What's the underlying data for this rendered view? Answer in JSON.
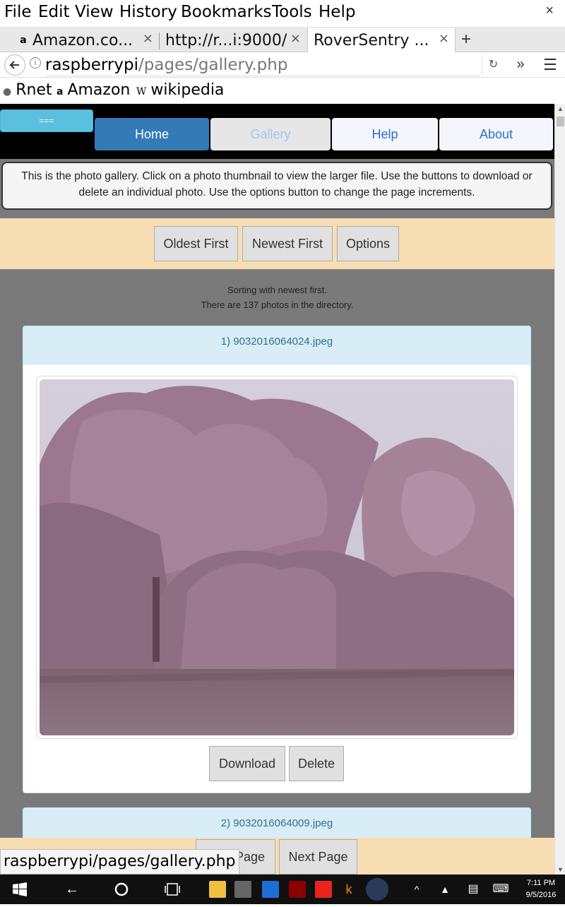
{
  "menubar": {
    "items": [
      "File",
      "Edit",
      "View",
      "History",
      "Bookmarks",
      "Tools",
      "Help"
    ],
    "close": "×"
  },
  "tabs": [
    {
      "label": "Amazon.co...",
      "favicon": "a"
    },
    {
      "label": "http://r...i:9000/"
    },
    {
      "label": "RoverSentry ..."
    }
  ],
  "tab_close": "×",
  "new_tab": "+",
  "urlbar": {
    "host": "raspberrypi",
    "path": "/pages/gallery.php"
  },
  "bookmarks": [
    {
      "label": "Rnet",
      "icon": "globe-icon"
    },
    {
      "label": "Amazon",
      "icon": "amazon-icon"
    },
    {
      "label": "wikipedia",
      "icon": "wikipedia-icon"
    }
  ],
  "nav": {
    "toggle": "===",
    "home": "Home",
    "gallery": "Gallery",
    "help": "Help",
    "about": "About"
  },
  "intro": "This is the photo gallery. Click on a photo thumbnail to view the larger file. Use the buttons to download or delete an individual photo. Use the options button to change the page increments.",
  "sort": {
    "oldest": "Oldest First",
    "newest": "Newest First",
    "options": "Options"
  },
  "status": {
    "line1": "Sorting with newest first.",
    "line2": "There are 137 photos in the directory."
  },
  "photos": [
    {
      "title": "1) 9032016064024.jpeg"
    },
    {
      "title": "2) 9032016064009.jpeg"
    }
  ],
  "photo_actions": {
    "download": "Download",
    "delete": "Delete"
  },
  "pagination": {
    "prev": "Page",
    "next": "Next Page"
  },
  "status_link": "raspberrypi/pages/gallery.php",
  "clock": {
    "time": "7:11 PM",
    "date": "9/5/2016"
  },
  "colors": {
    "nav_active": "#337ab7",
    "sort_bar": "#f7deb2",
    "panel_head": "#d9edf7",
    "page_bg": "#7a7a7a"
  }
}
